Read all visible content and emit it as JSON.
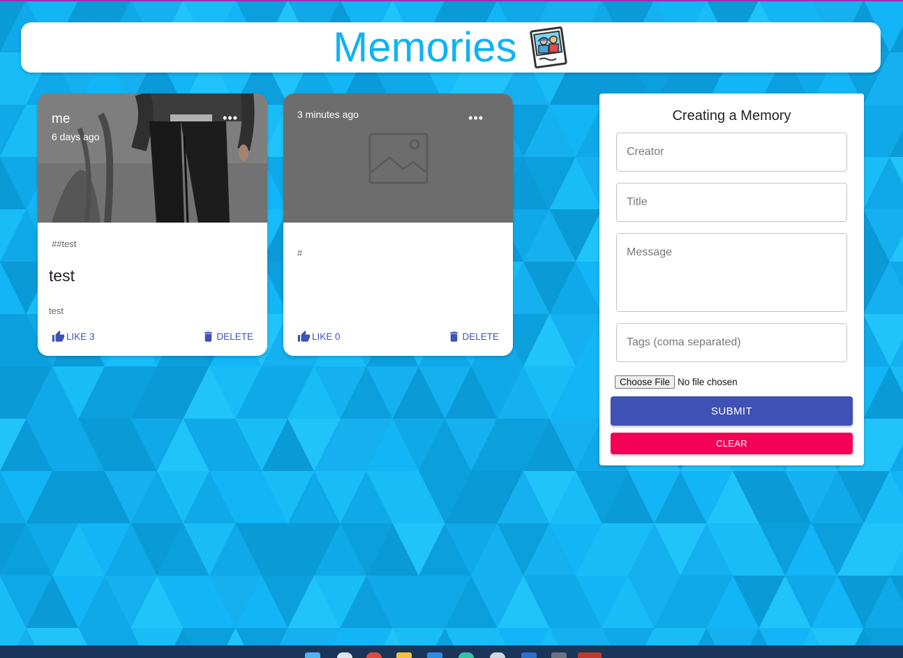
{
  "header": {
    "title": "Memories",
    "logo_icon": "photo-memories-icon"
  },
  "posts": [
    {
      "creator": "me",
      "time": "6 days ago",
      "tags": "##test",
      "title": "test",
      "message": "test",
      "like_label": "LIKE 3",
      "delete_label": "DELETE",
      "more_label": "•••",
      "image": "photo"
    },
    {
      "creator": "",
      "time": "3 minutes ago",
      "tags": "#",
      "title": "",
      "message": "",
      "like_label": "LIKE 0",
      "delete_label": "DELETE",
      "more_label": "•••",
      "image": "placeholder-image-icon"
    }
  ],
  "form": {
    "title": "Creating a Memory",
    "creator_placeholder": "Creator",
    "title_placeholder": "Title",
    "message_placeholder": "Message",
    "tags_placeholder": "Tags (coma separated)",
    "file_button": "Choose File",
    "file_status": "No file chosen",
    "submit_label": "SUBMIT",
    "clear_label": "CLEAR"
  },
  "colors": {
    "background": "#12b5f5",
    "title": "#10b3f2",
    "primary": "#3f51b5",
    "secondary": "#f50057",
    "taskbar": "#1b3559"
  }
}
